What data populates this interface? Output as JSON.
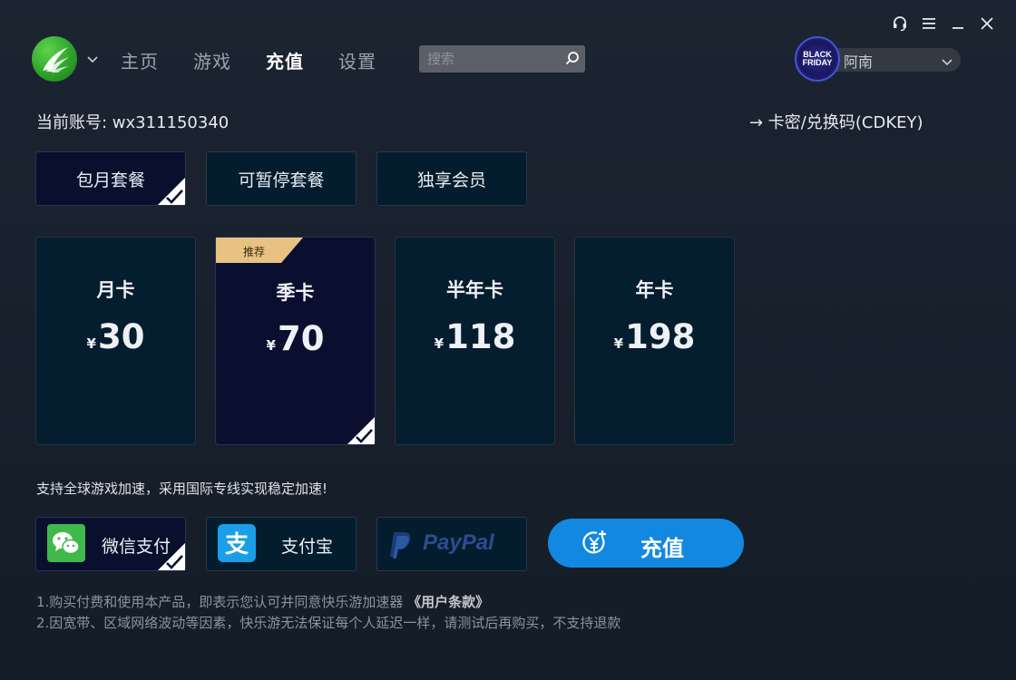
{
  "nav": {
    "items": [
      "主页",
      "游戏",
      "充值",
      "设置"
    ],
    "active_index": 2
  },
  "search": {
    "placeholder": "搜索"
  },
  "user": {
    "name": "阿南",
    "avatar_line1": "BLACK",
    "avatar_line2": "FRIDAY"
  },
  "account": {
    "text": "当前账号: wx311150340"
  },
  "cdkey": {
    "label": "→ 卡密/兑换码(CDKEY)"
  },
  "tabs": [
    {
      "label": "包月套餐",
      "selected": true
    },
    {
      "label": "可暂停套餐",
      "selected": false
    },
    {
      "label": "独享会员",
      "selected": false
    }
  ],
  "plans": [
    {
      "name": "月卡",
      "currency": "¥",
      "price": "30",
      "selected": false,
      "badge": ""
    },
    {
      "name": "季卡",
      "currency": "¥",
      "price": "70",
      "selected": true,
      "badge": "推荐"
    },
    {
      "name": "半年卡",
      "currency": "¥",
      "price": "118",
      "selected": false,
      "badge": ""
    },
    {
      "name": "年卡",
      "currency": "¥",
      "price": "198",
      "selected": false,
      "badge": ""
    }
  ],
  "tagline": "支持全球游戏加速，采用国际专线实现稳定加速!",
  "payments": [
    {
      "label": "微信支付",
      "icon": "wechat-pay-icon",
      "selected": true
    },
    {
      "label": "支付宝",
      "icon": "alipay-icon",
      "selected": false
    },
    {
      "label": "PayPal",
      "icon": "paypal-icon",
      "selected": false
    }
  ],
  "recharge": {
    "label": "充值",
    "icon": "yen-coin-plus-icon"
  },
  "notes": {
    "line1_prefix": "1.购买付费和使用本产品，即表示您认可并同意快乐游加速器 ",
    "terms_link": "《用户条款》",
    "line2": "2.因宽带、区域网络波动等因素，快乐游无法保证每个人延迟一样，请测试后再购买，不支持退款"
  },
  "colors": {
    "accent_blue": "#1288e0",
    "ribbon_gold": "#e7c283",
    "logo_green": "#2ea32a"
  }
}
